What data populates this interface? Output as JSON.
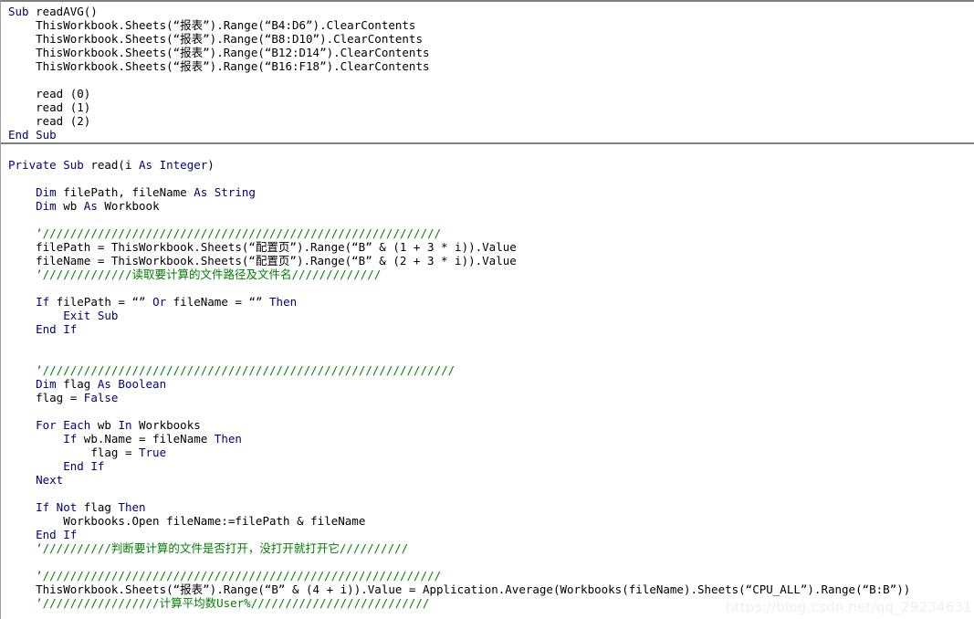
{
  "editor": {
    "title": "VBA Code Editor",
    "colors": {
      "background": "#ffffff",
      "keyword": "#000080",
      "comment": "#008000",
      "text": "#000000",
      "separator": "#808080",
      "watermark": "#f0f0f0"
    },
    "separator_after_line_index": 9,
    "watermark": "https://blog.csdn.net/qq_29234631"
  },
  "code": {
    "lines": [
      {
        "indent": 0,
        "tokens": [
          {
            "t": "kw",
            "s": "Sub"
          },
          {
            "t": "txt",
            "s": " readAVG()"
          }
        ]
      },
      {
        "indent": 1,
        "tokens": [
          {
            "t": "txt",
            "s": "ThisWorkbook.Sheets(“报表”).Range(“B4:D6”).ClearContents"
          }
        ]
      },
      {
        "indent": 1,
        "tokens": [
          {
            "t": "txt",
            "s": "ThisWorkbook.Sheets(“报表”).Range(“B8:D10”).ClearContents"
          }
        ]
      },
      {
        "indent": 1,
        "tokens": [
          {
            "t": "txt",
            "s": "ThisWorkbook.Sheets(“报表”).Range(“B12:D14”).ClearContents"
          }
        ]
      },
      {
        "indent": 1,
        "tokens": [
          {
            "t": "txt",
            "s": "ThisWorkbook.Sheets(“报表”).Range(“B16:F18”).ClearContents"
          }
        ]
      },
      {
        "indent": 0,
        "tokens": []
      },
      {
        "indent": 1,
        "tokens": [
          {
            "t": "txt",
            "s": "read (0)"
          }
        ]
      },
      {
        "indent": 1,
        "tokens": [
          {
            "t": "txt",
            "s": "read (1)"
          }
        ]
      },
      {
        "indent": 1,
        "tokens": [
          {
            "t": "txt",
            "s": "read (2)"
          }
        ]
      },
      {
        "indent": 0,
        "tokens": [
          {
            "t": "kw",
            "s": "End Sub"
          }
        ]
      },
      {
        "indent": 0,
        "tokens": []
      },
      {
        "indent": 0,
        "tokens": [
          {
            "t": "kw",
            "s": "Private Sub"
          },
          {
            "t": "txt",
            "s": " read(i "
          },
          {
            "t": "kw",
            "s": "As Integer"
          },
          {
            "t": "txt",
            "s": ")"
          }
        ]
      },
      {
        "indent": 0,
        "tokens": []
      },
      {
        "indent": 1,
        "tokens": [
          {
            "t": "kw",
            "s": "Dim"
          },
          {
            "t": "txt",
            "s": " filePath, fileName "
          },
          {
            "t": "kw",
            "s": "As String"
          }
        ]
      },
      {
        "indent": 1,
        "tokens": [
          {
            "t": "kw",
            "s": "Dim"
          },
          {
            "t": "txt",
            "s": " wb "
          },
          {
            "t": "kw",
            "s": "As"
          },
          {
            "t": "txt",
            "s": " Workbook"
          }
        ]
      },
      {
        "indent": 0,
        "tokens": []
      },
      {
        "indent": 1,
        "tokens": [
          {
            "t": "cmt",
            "s": "’//////////////////////////////////////////////////////////"
          }
        ]
      },
      {
        "indent": 1,
        "tokens": [
          {
            "t": "txt",
            "s": "filePath = ThisWorkbook.Sheets(“配置页”).Range(“B” & (1 + 3 * i)).Value"
          }
        ]
      },
      {
        "indent": 1,
        "tokens": [
          {
            "t": "txt",
            "s": "fileName = ThisWorkbook.Sheets(“配置页”).Range(“B” & (2 + 3 * i)).Value"
          }
        ]
      },
      {
        "indent": 1,
        "tokens": [
          {
            "t": "cmt",
            "s": "’/////////////读取要计算的文件路径及文件名/////////////"
          }
        ]
      },
      {
        "indent": 0,
        "tokens": []
      },
      {
        "indent": 1,
        "tokens": [
          {
            "t": "kw",
            "s": "If"
          },
          {
            "t": "txt",
            "s": " filePath = "
          },
          {
            "t": "txt",
            "s": "“”"
          },
          {
            "t": "kw",
            "s": " Or"
          },
          {
            "t": "txt",
            "s": " fileName = "
          },
          {
            "t": "txt",
            "s": "“”"
          },
          {
            "t": "kw",
            "s": " Then"
          }
        ]
      },
      {
        "indent": 2,
        "tokens": [
          {
            "t": "kw",
            "s": "Exit Sub"
          }
        ]
      },
      {
        "indent": 1,
        "tokens": [
          {
            "t": "kw",
            "s": "End If"
          }
        ]
      },
      {
        "indent": 0,
        "tokens": []
      },
      {
        "indent": 0,
        "tokens": []
      },
      {
        "indent": 1,
        "tokens": [
          {
            "t": "cmt",
            "s": "’////////////////////////////////////////////////////////////"
          }
        ]
      },
      {
        "indent": 1,
        "tokens": [
          {
            "t": "kw",
            "s": "Dim"
          },
          {
            "t": "txt",
            "s": " flag "
          },
          {
            "t": "kw",
            "s": "As Boolean"
          }
        ]
      },
      {
        "indent": 1,
        "tokens": [
          {
            "t": "txt",
            "s": "flag = "
          },
          {
            "t": "kw",
            "s": "False"
          }
        ]
      },
      {
        "indent": 0,
        "tokens": []
      },
      {
        "indent": 1,
        "tokens": [
          {
            "t": "kw",
            "s": "For Each"
          },
          {
            "t": "txt",
            "s": " wb "
          },
          {
            "t": "kw",
            "s": "In"
          },
          {
            "t": "txt",
            "s": " Workbooks"
          }
        ]
      },
      {
        "indent": 2,
        "tokens": [
          {
            "t": "kw",
            "s": "If"
          },
          {
            "t": "txt",
            "s": " wb.Name = fileName "
          },
          {
            "t": "kw",
            "s": "Then"
          }
        ]
      },
      {
        "indent": 3,
        "tokens": [
          {
            "t": "txt",
            "s": "flag = "
          },
          {
            "t": "kw",
            "s": "True"
          }
        ]
      },
      {
        "indent": 2,
        "tokens": [
          {
            "t": "kw",
            "s": "End If"
          }
        ]
      },
      {
        "indent": 1,
        "tokens": [
          {
            "t": "kw",
            "s": "Next"
          }
        ]
      },
      {
        "indent": 0,
        "tokens": []
      },
      {
        "indent": 1,
        "tokens": [
          {
            "t": "kw",
            "s": "If Not"
          },
          {
            "t": "txt",
            "s": " flag "
          },
          {
            "t": "kw",
            "s": "Then"
          }
        ]
      },
      {
        "indent": 2,
        "tokens": [
          {
            "t": "txt",
            "s": "Workbooks.Open fileName:=filePath & fileName"
          }
        ]
      },
      {
        "indent": 1,
        "tokens": [
          {
            "t": "kw",
            "s": "End If"
          }
        ]
      },
      {
        "indent": 1,
        "tokens": [
          {
            "t": "cmt",
            "s": "’//////////判断要计算的文件是否打开，没打开就打开它//////////"
          }
        ]
      },
      {
        "indent": 0,
        "tokens": []
      },
      {
        "indent": 1,
        "tokens": [
          {
            "t": "cmt",
            "s": "’//////////////////////////////////////////////////////////"
          }
        ]
      },
      {
        "indent": 1,
        "tokens": [
          {
            "t": "txt",
            "s": "ThisWorkbook.Sheets(“报表”).Range(“B” & (4 + i)).Value = Application.Average(Workbooks(fileName).Sheets(“CPU_ALL”).Range(“B:B”))"
          }
        ]
      },
      {
        "indent": 1,
        "tokens": [
          {
            "t": "cmt",
            "s": "’/////////////////计算平均数User%//////////////////////////"
          }
        ]
      }
    ]
  }
}
